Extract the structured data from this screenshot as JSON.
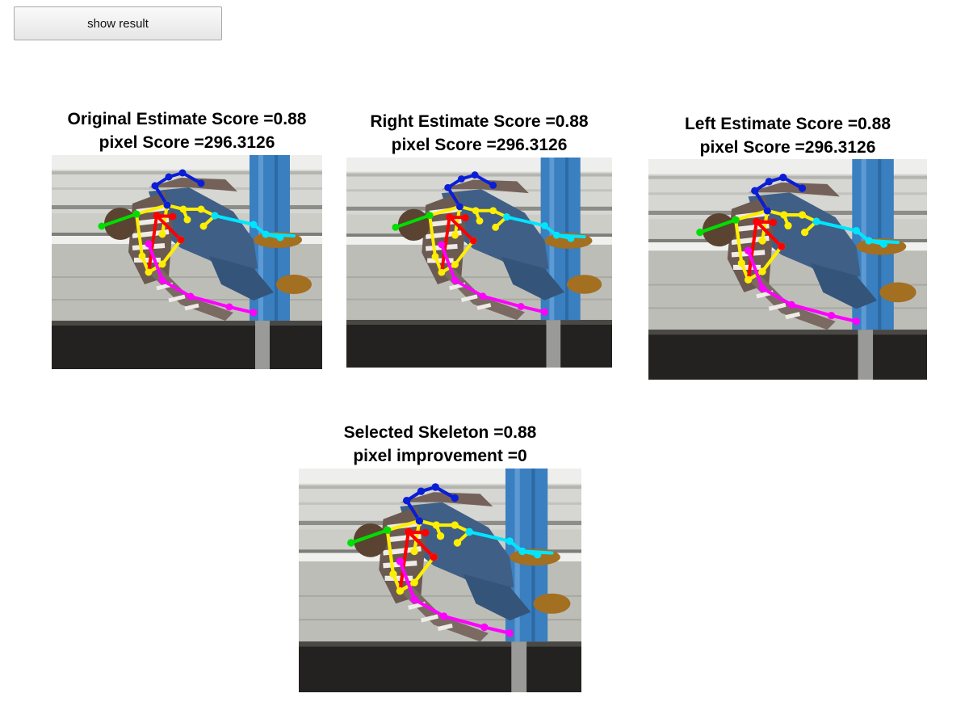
{
  "toolbar": {
    "show_result_label": "show result"
  },
  "panels": {
    "original": {
      "line1": "Original Estimate Score =0.88",
      "line2": "pixel Score =296.3126"
    },
    "right": {
      "line1": "Right Estimate Score =0.88",
      "line2": "pixel Score =296.3126"
    },
    "left": {
      "line1": "Left Estimate Score =0.88",
      "line2": "pixel Score =296.3126"
    },
    "selected": {
      "line1": "Selected Skeleton =0.88",
      "line2": "pixel improvement =0"
    }
  },
  "skeleton_colors": {
    "head": "#0a1ed6",
    "torso": "#ffee00",
    "right_arm": "#ff0000",
    "left_arm": "#00e5ff",
    "neck": "#00dd00",
    "legs": "#ff00ff"
  }
}
